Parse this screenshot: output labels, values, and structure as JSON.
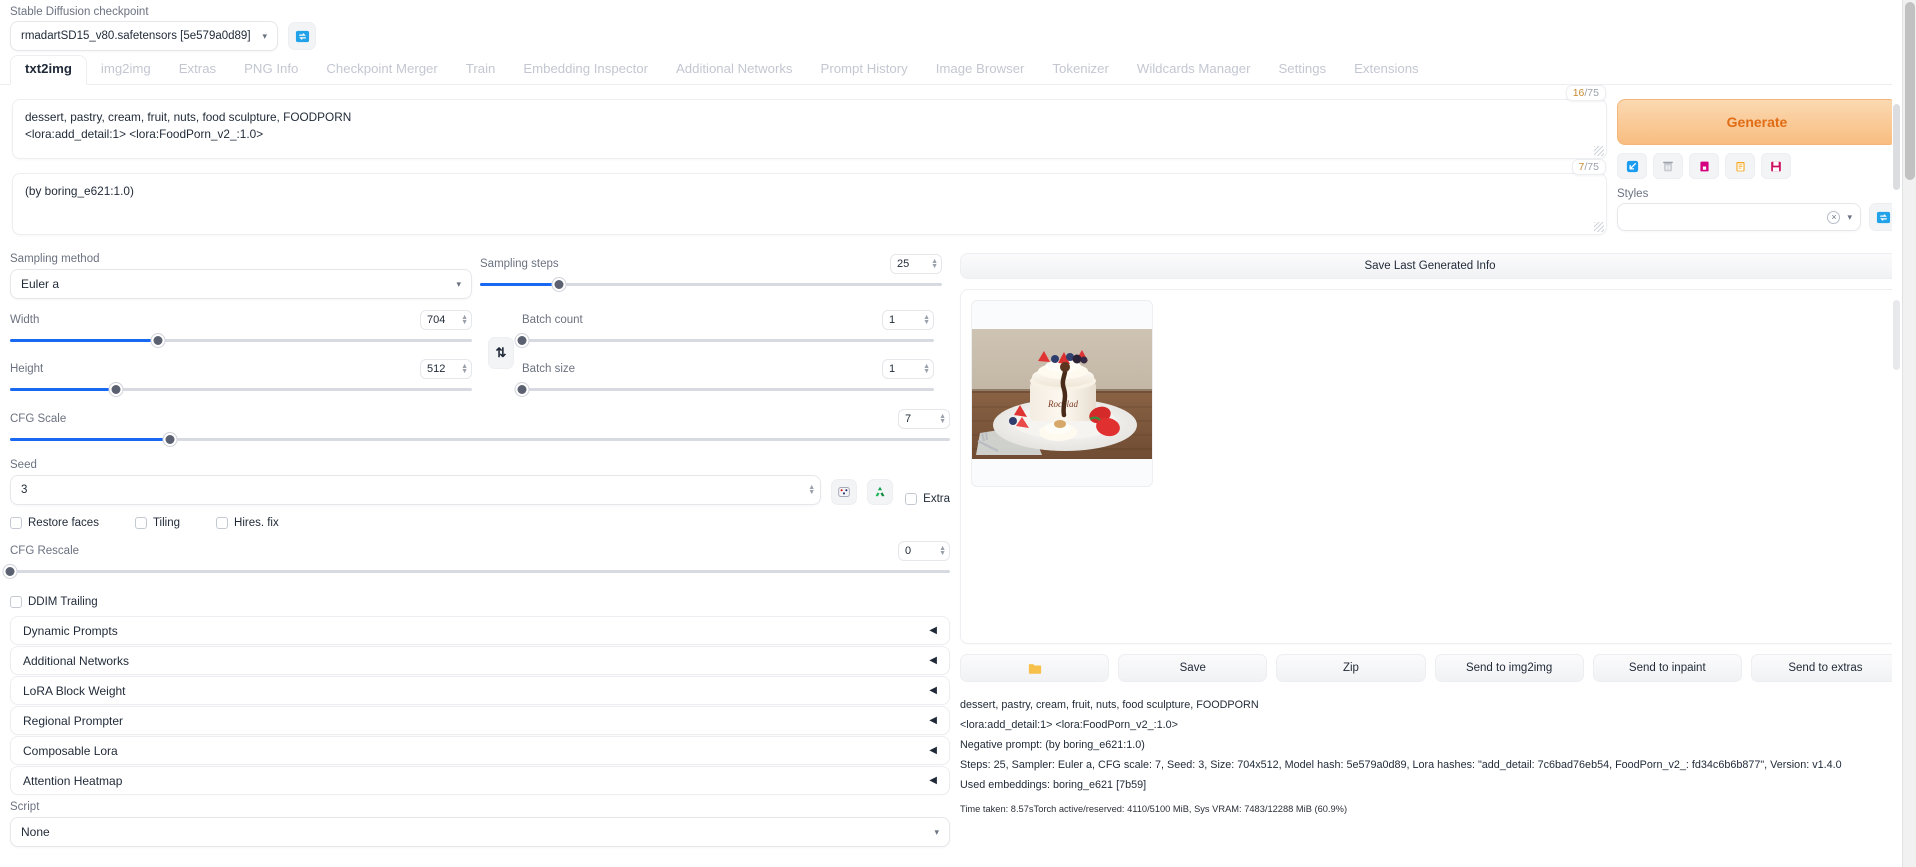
{
  "checkpoint": {
    "label": "Stable Diffusion checkpoint",
    "value": "rmadartSD15_v80.safetensors [5e579a0d89]",
    "caret": "▾",
    "refresh_icon": "🔄"
  },
  "tabs": [
    {
      "label": "txt2img",
      "active": true
    },
    {
      "label": "img2img",
      "active": false
    },
    {
      "label": "Extras",
      "active": false
    },
    {
      "label": "PNG Info",
      "active": false
    },
    {
      "label": "Checkpoint Merger",
      "active": false
    },
    {
      "label": "Train",
      "active": false
    },
    {
      "label": "Embedding Inspector",
      "active": false
    },
    {
      "label": "Additional Networks",
      "active": false
    },
    {
      "label": "Prompt History",
      "active": false
    },
    {
      "label": "Image Browser",
      "active": false
    },
    {
      "label": "Tokenizer",
      "active": false
    },
    {
      "label": "Wildcards Manager",
      "active": false
    },
    {
      "label": "Settings",
      "active": false
    },
    {
      "label": "Extensions",
      "active": false
    }
  ],
  "prompt": {
    "positive_line1": "dessert, pastry, cream, fruit, nuts, food sculpture, FOODPORN",
    "positive_line2": "<lora:add_detail:1>  <lora:FoodPorn_v2_:1.0>",
    "positive_tokens": "16",
    "positive_tokens_max": "/75",
    "negative_line1": "(by boring_e621:1.0)",
    "negative_tokens": "7",
    "negative_tokens_max": "/75"
  },
  "generate": {
    "label": "Generate",
    "accent": "#e06c16",
    "icons": [
      {
        "name": "restore-progress-icon",
        "glyph": "↙"
      },
      {
        "name": "trash-icon",
        "glyph": "🗑"
      },
      {
        "name": "extra-networks-icon",
        "glyph": "🎴"
      },
      {
        "name": "apply-style-icon",
        "glyph": "📋"
      },
      {
        "name": "save-style-icon",
        "glyph": "💾"
      }
    ]
  },
  "styles": {
    "label": "Styles",
    "value": "",
    "clear_icon": "×",
    "caret": "▾",
    "refresh_icon": "🔄"
  },
  "sampling": {
    "method_label": "Sampling method",
    "method_value": "Euler a",
    "steps_label": "Sampling steps",
    "steps_value": "25",
    "steps_pct": 17
  },
  "dimensions": {
    "width_label": "Width",
    "width_value": "704",
    "width_pct": 32,
    "height_label": "Height",
    "height_value": "512",
    "height_pct": 23,
    "swap_icon": "⇅"
  },
  "batch": {
    "count_label": "Batch count",
    "count_value": "1",
    "count_pct": 0,
    "size_label": "Batch size",
    "size_value": "1",
    "size_pct": 0
  },
  "cfg": {
    "label": "CFG Scale",
    "value": "7",
    "pct": 23,
    "rescale_label": "CFG Rescale",
    "rescale_value": "0",
    "rescale_pct": 0
  },
  "seed": {
    "label": "Seed",
    "value": "3",
    "dice_icon": "🎲",
    "recycle_icon": "♻",
    "extra_label": "Extra"
  },
  "toggles": [
    {
      "label": "Restore faces",
      "checked": false
    },
    {
      "label": "Tiling",
      "checked": false
    },
    {
      "label": "Hires. fix",
      "checked": false
    }
  ],
  "ddim": {
    "label": "DDIM Trailing",
    "checked": false
  },
  "accordions": [
    {
      "label": "Dynamic Prompts",
      "arrow": "◀"
    },
    {
      "label": "Additional Networks",
      "arrow": "◀"
    },
    {
      "label": "LoRA Block Weight",
      "arrow": "◀"
    },
    {
      "label": "Regional Prompter",
      "arrow": "◀"
    },
    {
      "label": "Composable Lora",
      "arrow": "◀"
    },
    {
      "label": "Attention Heatmap",
      "arrow": "◀"
    }
  ],
  "script": {
    "label": "Script",
    "value": "None",
    "caret": "▾"
  },
  "output": {
    "save_info_label": "Save Last Generated Info",
    "buttons": [
      {
        "label": "",
        "icon": "📁",
        "name": "open-folder-button"
      },
      {
        "label": "Save",
        "icon": "",
        "name": "save-button"
      },
      {
        "label": "Zip",
        "icon": "",
        "name": "zip-button"
      },
      {
        "label": "Send to img2img",
        "icon": "",
        "name": "send-to-img2img-button"
      },
      {
        "label": "Send to inpaint",
        "icon": "",
        "name": "send-to-inpaint-button"
      },
      {
        "label": "Send to extras",
        "icon": "",
        "name": "send-to-extras-button"
      }
    ],
    "info_lines": [
      "dessert, pastry, cream, fruit, nuts, food sculpture, FOODPORN",
      "<lora:add_detail:1> <lora:FoodPorn_v2_:1.0>",
      "Negative prompt: (by boring_e621:1.0)",
      "Steps: 25, Sampler: Euler a, CFG scale: 7, Seed: 3, Size: 704x512, Model hash: 5e579a0d89, Lora hashes: \"add_detail: 7c6bad76eb54, FoodPorn_v2_: fd34c6b6b877\", Version: v1.4.0",
      "Used embeddings: boring_e621 [7b59]"
    ],
    "time_taken": "Time taken: 8.57sTorch active/reserved: 4110/5100 MiB, Sys VRAM: 7483/12288 MiB (60.9%)"
  }
}
